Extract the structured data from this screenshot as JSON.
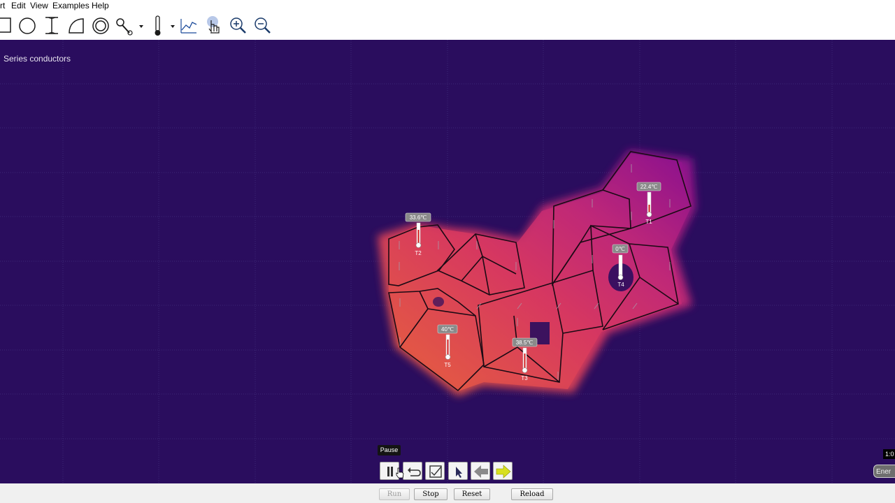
{
  "menu": [
    "rt",
    "Edit",
    "View",
    "Examples",
    "Help"
  ],
  "toolbar_tools": [
    "rectangle-tool",
    "ellipse-tool",
    "text-tool",
    "curve-tool",
    "ring-tool",
    "heliostat-tool",
    "thermometer-tool",
    "graph-tool",
    "heat-flux-tool",
    "zoom-in-tool",
    "zoom-out-tool"
  ],
  "scene": {
    "title": "Series conductors"
  },
  "thermometers": [
    {
      "id": "T1",
      "reading": "22.4℃"
    },
    {
      "id": "T2",
      "reading": "33.6℃"
    },
    {
      "id": "T3",
      "reading": "38.5℃"
    },
    {
      "id": "T4",
      "reading": "0℃"
    },
    {
      "id": "T5",
      "reading": "40℃"
    }
  ],
  "controls": {
    "tooltip": "Pause",
    "scale": "1:0",
    "energy": "Ener"
  },
  "buttons": {
    "run": "Run",
    "stop": "Stop",
    "reset": "Reset",
    "reload": "Reload"
  },
  "colors": {
    "background": "#2a0d5e",
    "hot": "#e05a48",
    "mid": "#c8306a",
    "cool": "#9a1a9a",
    "cold": "#2a0d5e"
  }
}
